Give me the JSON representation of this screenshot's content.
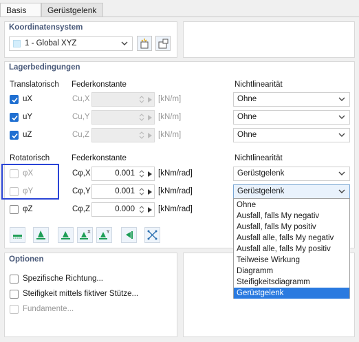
{
  "tabs": [
    {
      "label": "Basis",
      "active": true
    },
    {
      "label": "Gerüstgelenk",
      "active": false
    }
  ],
  "coord": {
    "title": "Koordinatensystem",
    "selected": "1 - Global XYZ"
  },
  "support": {
    "title": "Lagerbedingungen",
    "translational": {
      "header": "Translatorisch",
      "spring_header": "Federkonstante",
      "nonlin_header": "Nichtlinearität",
      "rows": [
        {
          "label": "uX",
          "checked": true,
          "spring_label": "Cu,X",
          "unit": "[kN/m]",
          "nonlin": "Ohne"
        },
        {
          "label": "uY",
          "checked": true,
          "spring_label": "Cu,Y",
          "unit": "[kN/m]",
          "nonlin": "Ohne"
        },
        {
          "label": "uZ",
          "checked": true,
          "spring_label": "Cu,Z",
          "unit": "[kN/m]",
          "nonlin": "Ohne"
        }
      ]
    },
    "rotational": {
      "header": "Rotatorisch",
      "spring_header": "Federkonstante",
      "nonlin_header": "Nichtlinearität",
      "rows": [
        {
          "label": "φX",
          "checked": false,
          "spring_label": "Cφ,X",
          "value": "0.001",
          "unit": "[kNm/rad]",
          "nonlin": "Gerüstgelenk"
        },
        {
          "label": "φY",
          "checked": false,
          "spring_label": "Cφ,Y",
          "value": "0.001",
          "unit": "[kNm/rad]",
          "nonlin": "Gerüstgelenk"
        },
        {
          "label": "φZ",
          "checked": false,
          "spring_label": "Cφ,Z",
          "value": "0.000",
          "unit": "[kNm/rad]",
          "nonlin": ""
        }
      ]
    }
  },
  "dropdown_options": [
    "Ohne",
    "Ausfall, falls My negativ",
    "Ausfall, falls My positiv",
    "Ausfall alle, falls My negativ",
    "Ausfall alle, falls My positiv",
    "Teilweise Wirkung",
    "Diagramm",
    "Steifigkeitsdiagramm",
    "Gerüstgelenk"
  ],
  "dropdown_highlight": "Gerüstgelenk",
  "options": {
    "title": "Optionen",
    "items": [
      {
        "label": "Spezifische Richtung...",
        "enabled": true
      },
      {
        "label": "Steifigkeit mittels fiktiver Stütze...",
        "enabled": true
      },
      {
        "label": "Fundamente...",
        "enabled": false
      }
    ]
  },
  "colors": {
    "accent": "#1f6fd1",
    "section_title": "#4a5a7a",
    "highlight": "#2a7ae0",
    "annotation_box": "#2a44d6",
    "icon_green": "#1e9e57"
  }
}
